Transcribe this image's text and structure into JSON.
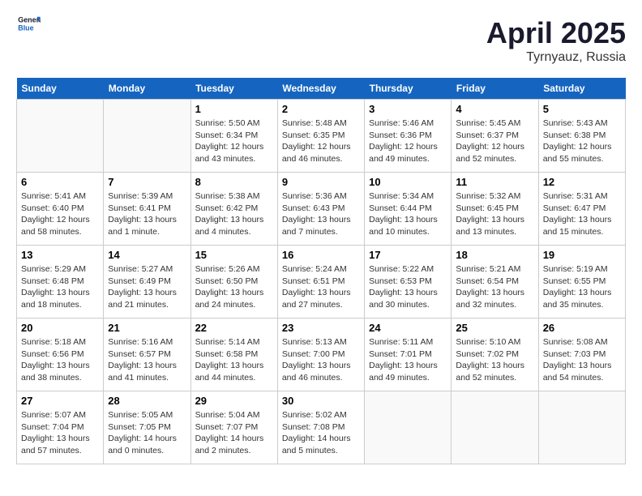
{
  "header": {
    "logo_line1": "General",
    "logo_line2": "Blue",
    "month": "April 2025",
    "location": "Tyrnyauz, Russia"
  },
  "weekdays": [
    "Sunday",
    "Monday",
    "Tuesday",
    "Wednesday",
    "Thursday",
    "Friday",
    "Saturday"
  ],
  "weeks": [
    [
      {
        "day": "",
        "detail": ""
      },
      {
        "day": "",
        "detail": ""
      },
      {
        "day": "1",
        "detail": "Sunrise: 5:50 AM\nSunset: 6:34 PM\nDaylight: 12 hours and 43 minutes."
      },
      {
        "day": "2",
        "detail": "Sunrise: 5:48 AM\nSunset: 6:35 PM\nDaylight: 12 hours and 46 minutes."
      },
      {
        "day": "3",
        "detail": "Sunrise: 5:46 AM\nSunset: 6:36 PM\nDaylight: 12 hours and 49 minutes."
      },
      {
        "day": "4",
        "detail": "Sunrise: 5:45 AM\nSunset: 6:37 PM\nDaylight: 12 hours and 52 minutes."
      },
      {
        "day": "5",
        "detail": "Sunrise: 5:43 AM\nSunset: 6:38 PM\nDaylight: 12 hours and 55 minutes."
      }
    ],
    [
      {
        "day": "6",
        "detail": "Sunrise: 5:41 AM\nSunset: 6:40 PM\nDaylight: 12 hours and 58 minutes."
      },
      {
        "day": "7",
        "detail": "Sunrise: 5:39 AM\nSunset: 6:41 PM\nDaylight: 13 hours and 1 minute."
      },
      {
        "day": "8",
        "detail": "Sunrise: 5:38 AM\nSunset: 6:42 PM\nDaylight: 13 hours and 4 minutes."
      },
      {
        "day": "9",
        "detail": "Sunrise: 5:36 AM\nSunset: 6:43 PM\nDaylight: 13 hours and 7 minutes."
      },
      {
        "day": "10",
        "detail": "Sunrise: 5:34 AM\nSunset: 6:44 PM\nDaylight: 13 hours and 10 minutes."
      },
      {
        "day": "11",
        "detail": "Sunrise: 5:32 AM\nSunset: 6:45 PM\nDaylight: 13 hours and 13 minutes."
      },
      {
        "day": "12",
        "detail": "Sunrise: 5:31 AM\nSunset: 6:47 PM\nDaylight: 13 hours and 15 minutes."
      }
    ],
    [
      {
        "day": "13",
        "detail": "Sunrise: 5:29 AM\nSunset: 6:48 PM\nDaylight: 13 hours and 18 minutes."
      },
      {
        "day": "14",
        "detail": "Sunrise: 5:27 AM\nSunset: 6:49 PM\nDaylight: 13 hours and 21 minutes."
      },
      {
        "day": "15",
        "detail": "Sunrise: 5:26 AM\nSunset: 6:50 PM\nDaylight: 13 hours and 24 minutes."
      },
      {
        "day": "16",
        "detail": "Sunrise: 5:24 AM\nSunset: 6:51 PM\nDaylight: 13 hours and 27 minutes."
      },
      {
        "day": "17",
        "detail": "Sunrise: 5:22 AM\nSunset: 6:53 PM\nDaylight: 13 hours and 30 minutes."
      },
      {
        "day": "18",
        "detail": "Sunrise: 5:21 AM\nSunset: 6:54 PM\nDaylight: 13 hours and 32 minutes."
      },
      {
        "day": "19",
        "detail": "Sunrise: 5:19 AM\nSunset: 6:55 PM\nDaylight: 13 hours and 35 minutes."
      }
    ],
    [
      {
        "day": "20",
        "detail": "Sunrise: 5:18 AM\nSunset: 6:56 PM\nDaylight: 13 hours and 38 minutes."
      },
      {
        "day": "21",
        "detail": "Sunrise: 5:16 AM\nSunset: 6:57 PM\nDaylight: 13 hours and 41 minutes."
      },
      {
        "day": "22",
        "detail": "Sunrise: 5:14 AM\nSunset: 6:58 PM\nDaylight: 13 hours and 44 minutes."
      },
      {
        "day": "23",
        "detail": "Sunrise: 5:13 AM\nSunset: 7:00 PM\nDaylight: 13 hours and 46 minutes."
      },
      {
        "day": "24",
        "detail": "Sunrise: 5:11 AM\nSunset: 7:01 PM\nDaylight: 13 hours and 49 minutes."
      },
      {
        "day": "25",
        "detail": "Sunrise: 5:10 AM\nSunset: 7:02 PM\nDaylight: 13 hours and 52 minutes."
      },
      {
        "day": "26",
        "detail": "Sunrise: 5:08 AM\nSunset: 7:03 PM\nDaylight: 13 hours and 54 minutes."
      }
    ],
    [
      {
        "day": "27",
        "detail": "Sunrise: 5:07 AM\nSunset: 7:04 PM\nDaylight: 13 hours and 57 minutes."
      },
      {
        "day": "28",
        "detail": "Sunrise: 5:05 AM\nSunset: 7:05 PM\nDaylight: 14 hours and 0 minutes."
      },
      {
        "day": "29",
        "detail": "Sunrise: 5:04 AM\nSunset: 7:07 PM\nDaylight: 14 hours and 2 minutes."
      },
      {
        "day": "30",
        "detail": "Sunrise: 5:02 AM\nSunset: 7:08 PM\nDaylight: 14 hours and 5 minutes."
      },
      {
        "day": "",
        "detail": ""
      },
      {
        "day": "",
        "detail": ""
      },
      {
        "day": "",
        "detail": ""
      }
    ]
  ]
}
